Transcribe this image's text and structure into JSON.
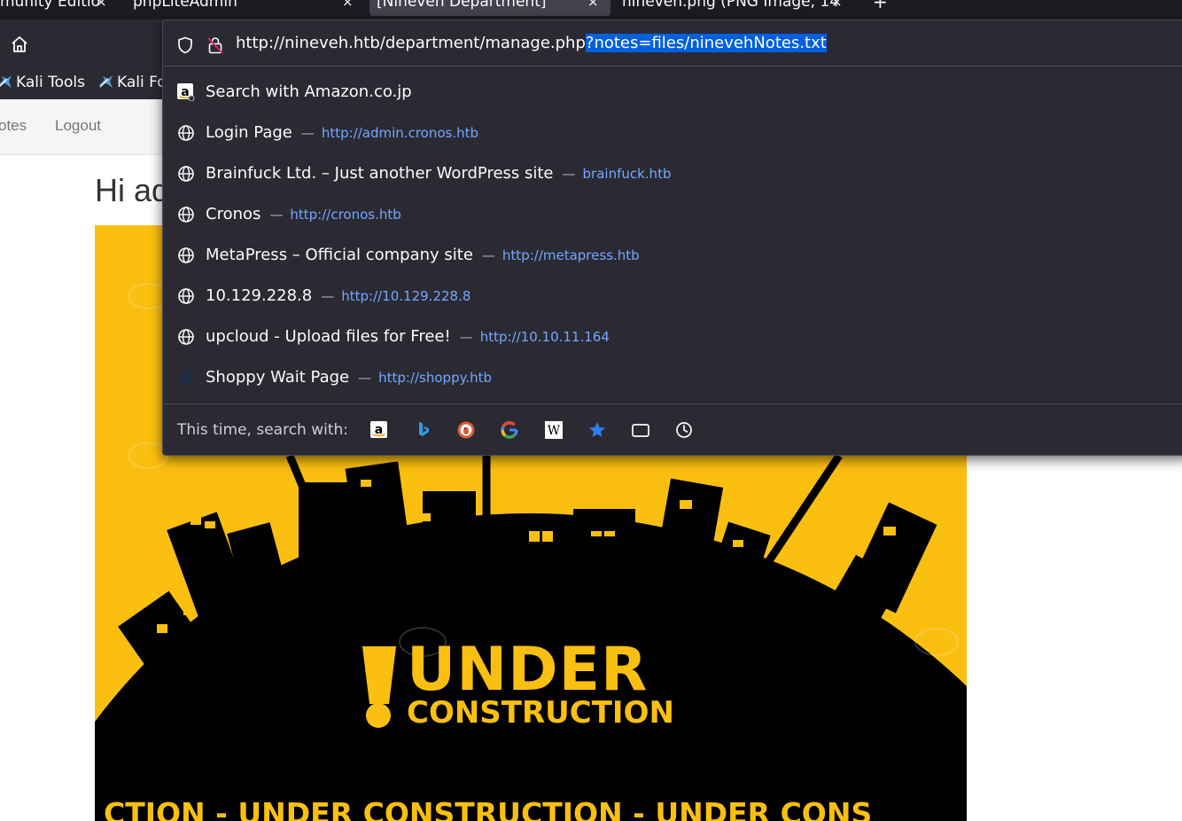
{
  "tabs": [
    {
      "label": "munity Editio",
      "close": "×"
    },
    {
      "label": "phpLiteAdmin",
      "close": "×"
    },
    {
      "label": "[Nineveh Department]",
      "close": "×"
    },
    {
      "label": "nineveh.png (PNG Image, 14",
      "close": "×"
    }
  ],
  "new_tab_label": "+",
  "bookmarks": [
    "Kali Tools",
    "Kali Fo"
  ],
  "urlbar": {
    "url_base": "http://nineveh.htb/department/manage.php",
    "url_selected": "?notes=files/ninevehNotes.txt"
  },
  "suggestions": [
    {
      "title": "Search with Amazon.co.jp",
      "url": "",
      "icon": "amazon-icon"
    },
    {
      "title": "Login Page",
      "url": "http://admin.cronos.htb",
      "icon": "globe-icon"
    },
    {
      "title": "Brainfuck Ltd. – Just another WordPress site",
      "url": "brainfuck.htb",
      "icon": "globe-icon"
    },
    {
      "title": "Cronos",
      "url": "http://cronos.htb",
      "icon": "globe-icon"
    },
    {
      "title": "MetaPress – Official company site",
      "url": "http://metapress.htb",
      "icon": "globe-icon"
    },
    {
      "title": "10.129.228.8",
      "url": "http://10.129.228.8",
      "icon": "globe-icon"
    },
    {
      "title": "upcloud - Upload files for Free!",
      "url": "http://10.10.11.164",
      "icon": "globe-icon"
    },
    {
      "title": "Shoppy Wait Page",
      "url": "http://shoppy.htb",
      "icon": "shoppy-icon"
    }
  ],
  "separator": "—",
  "search_with_label": "This time, search with:",
  "search_engines": [
    "amazon",
    "bing",
    "duckduckgo",
    "google",
    "wikipedia",
    "bookmarks",
    "tabs",
    "history"
  ],
  "page": {
    "nav_links": [
      "otes",
      "Logout"
    ],
    "greeting": "Hi ad",
    "image_text": {
      "under": "UNDER",
      "construction": "CONSTRUCTION",
      "banner": "CTION - UNDER  CONSTRUCTION - UNDER  CONS"
    }
  },
  "colors": {
    "chrome_bg": "#2b2a33",
    "tabstrip_bg": "#1c1b22",
    "selection": "#0060df",
    "link_blue": "#73a7ff",
    "construction_yellow": "#fbbf0f"
  }
}
